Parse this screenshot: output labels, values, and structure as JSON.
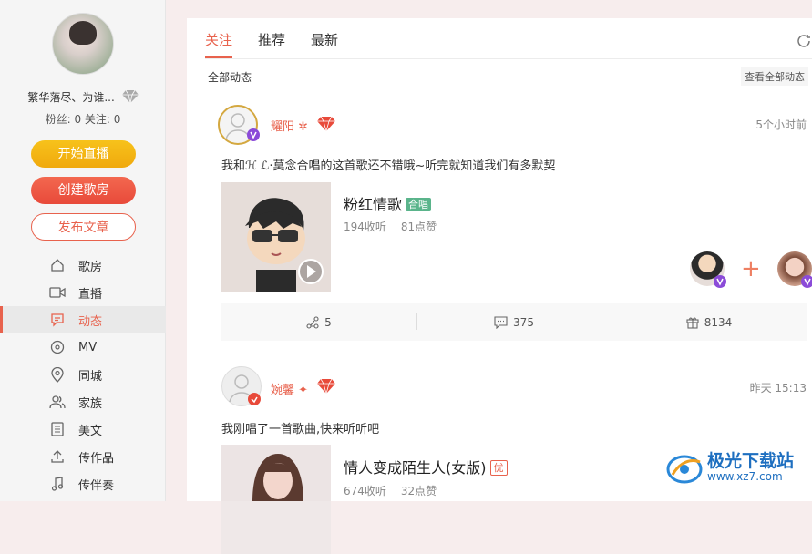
{
  "sidebar": {
    "username": "繁华落尽、为谁...",
    "fans_label": "粉丝:",
    "fans": "0",
    "follow_label": "关注:",
    "follow": "0",
    "btn_live": "开始直播",
    "btn_room": "创建歌房",
    "btn_post": "发布文章",
    "nav": [
      "歌房",
      "直播",
      "动态",
      "MV",
      "同城",
      "家族",
      "美文",
      "传作品",
      "传伴奏"
    ],
    "active_index": 2
  },
  "main": {
    "tabs": [
      "关注",
      "推荐",
      "最新"
    ],
    "section_title": "全部动态",
    "view_all": "查看全部动态"
  },
  "posts": [
    {
      "author": "耀阳",
      "time": "5个小时前",
      "text": "我和ℋ ℒ·莫念合唱的这首歌还不错哦~听完就知道我们有多默契",
      "song_title": "粉红情歌",
      "song_badge": "合唱",
      "plays": "194收听",
      "likes": "81点赞",
      "shares": "5",
      "comments": "375",
      "gifts": "8134"
    },
    {
      "author": "婉馨",
      "time": "昨天 15:13",
      "text": "我刚唱了一首歌曲,快来听听吧",
      "song_title": "情人变成陌生人(女版)",
      "song_badge": "优",
      "plays": "674收听",
      "likes": "32点赞"
    }
  ],
  "watermark": {
    "title": "极光下载站",
    "url": "www.xz7.com"
  },
  "colors": {
    "accent": "#e8624d",
    "live": "#f0a90d",
    "chorus_badge": "#5ab48b"
  }
}
